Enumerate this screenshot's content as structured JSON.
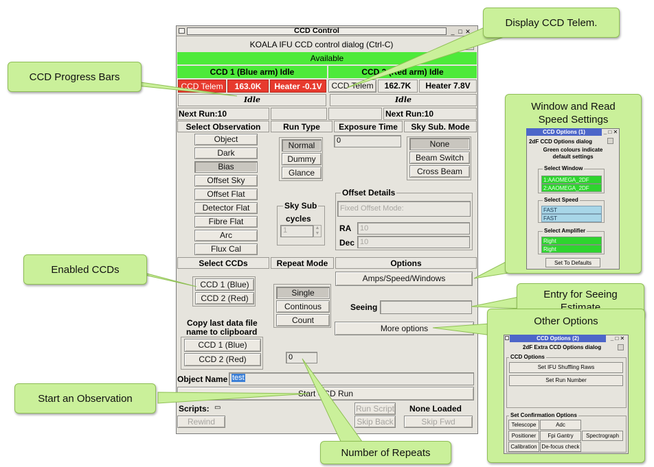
{
  "window": {
    "title": "CCD Control",
    "dialog_title": "KOALA IFU CCD control dialog (Ctrl-C)",
    "status": "Available",
    "colors": {
      "available_green": "#4dea3a",
      "telem_red": "#e73a2e",
      "callout_green": "#caf09a",
      "mini_title_blue": "#4d66c9"
    }
  },
  "ccd1": {
    "header": "CCD 1 (Blue arm) Idle",
    "telem_label": "CCD Telem",
    "temperature": "163.0K",
    "heater": "Heater -0.1V",
    "progress_status": "Idle",
    "next_run": "Next Run:10"
  },
  "ccd2": {
    "header": "CCD 2 (Red arm) Idle",
    "telem_label": "CCD Telem",
    "temperature": "162.7K",
    "heater": "Heater 7.8V",
    "progress_status": "Idle",
    "next_run": "Next Run:10"
  },
  "headers": {
    "select_observation": "Select Observation",
    "run_type": "Run Type",
    "exposure_time": "Exposure Time",
    "sky_sub_mode": "Sky Sub. Mode",
    "select_ccds": "Select CCDs",
    "repeat_mode": "Repeat Mode",
    "options": "Options"
  },
  "observations": [
    "Object",
    "Dark",
    "Bias",
    "Offset Sky",
    "Offset Flat",
    "Detector Flat",
    "Fibre Flat",
    "Arc",
    "Flux Cal"
  ],
  "run_types": [
    "Normal",
    "Dummy",
    "Glance"
  ],
  "exposure_value": "0",
  "sky_sub_modes": [
    "None",
    "Beam Switch",
    "Cross Beam"
  ],
  "offset": {
    "title": "Offset Details",
    "mode": "Fixed Offset Mode:",
    "ra_label": "RA",
    "ra_value": "10",
    "dec_label": "Dec",
    "dec_value": "10"
  },
  "sky_sub": {
    "title": "Sky Sub",
    "cycles": "cycles",
    "value": "1"
  },
  "select_ccds": [
    "CCD 1 (Blue)",
    "CCD 2 (Red)"
  ],
  "repeat_modes": [
    "Single",
    "Continous",
    "Count"
  ],
  "repeat_count": "0",
  "options": {
    "amps_speed": "Amps/Speed/Windows",
    "seeing_label": "Seeing",
    "more_options": "More options"
  },
  "clipboard": {
    "title_line1": "Copy last data file",
    "title_line2": "name to clipboard",
    "ccd1": "CCD 1 (Blue)",
    "ccd2": "CCD 2 (Red)"
  },
  "object_name": {
    "label": "Object Name",
    "value": "test"
  },
  "start_run": "Start CCD Run",
  "scripts": {
    "label": "Scripts:",
    "run_script": "Run Script",
    "status": "None Loaded",
    "rewind": "Rewind",
    "skip_back": "Skip Back",
    "skip_fwd": "Skip Fwd"
  },
  "callouts": {
    "progress_bars": "CCD Progress Bars",
    "display_telem": "Display CCD Telem.",
    "window_speed": "Window and Read\nSpeed Settings",
    "enabled_ccds": "Enabled CCDs",
    "seeing": "Entry for Seeing\nEstimate",
    "other_options": "Other Options",
    "start_obs": "Start an Observation",
    "repeats": "Number of Repeats"
  },
  "options_dialog": {
    "title": "CCD Options (1)",
    "dialog_title": "2dF CCD Options dialog",
    "note_line1": "Green colours indicate",
    "note_line2": "default settings",
    "select_window": "Select Window",
    "windows": [
      "1:AAOMEGA_2DF",
      "2:AAOMEGA_2DF"
    ],
    "select_speed": "Select Speed",
    "speeds": [
      "FAST",
      "FAST"
    ],
    "select_amplifier": "Select Amplifier",
    "amplifiers": [
      "Right",
      "Right"
    ],
    "defaults_button": "Set To Defaults"
  },
  "options_dialog2": {
    "title": "CCD Options (2)",
    "dialog_title": "2dF Extra CCD Options dialog",
    "ccd_options": "CCD Options",
    "ifu_shuffling": "Set IFU Shuffling Raws",
    "run_number": "Set Run Number",
    "confirmation": "Set Confirmation Options",
    "confirm_buttons": [
      "Telescope",
      "Adc",
      "Positioner",
      "Fpi Gantry",
      "Spectrograph",
      "Calibration",
      "De-focus check"
    ]
  }
}
